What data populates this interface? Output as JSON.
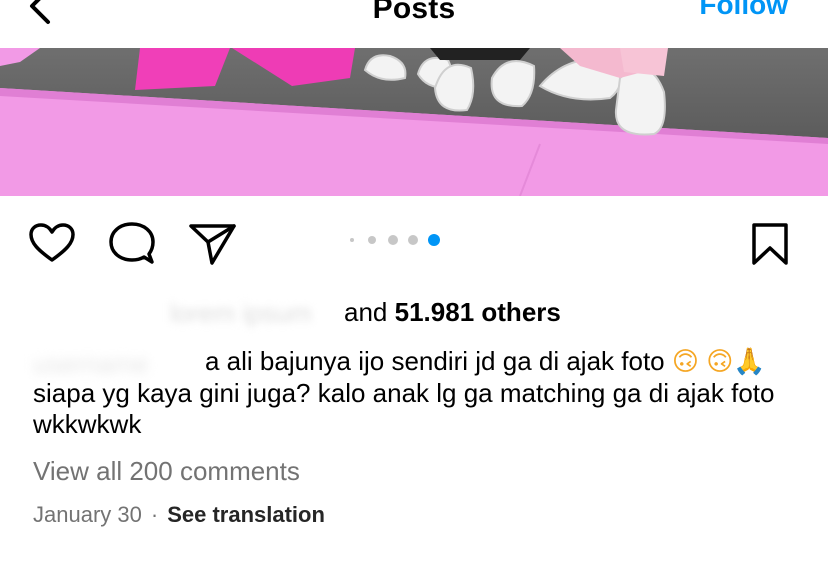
{
  "header": {
    "title": "Posts",
    "follow_label": "Follow"
  },
  "carousel": {
    "count": 5,
    "active_index": 4
  },
  "likes": {
    "prefix": "and",
    "count": "51.981",
    "suffix": "others"
  },
  "caption": {
    "line1": "a ali bajunya ijo sendiri jd ga di ajak foto",
    "line2": "siapa yg kaya gini juga? kalo anak lg ga matching ga di ajak foto wkkwkwk",
    "emoji_smile": "🙃",
    "emoji_pray": "🙏"
  },
  "comments": {
    "view_all": "View all 200 comments"
  },
  "meta": {
    "date": "January 30",
    "separator": "·",
    "see_translation": "See translation"
  },
  "colors": {
    "accent": "#0095f6",
    "muted": "#737373",
    "pink": "#f29ae6"
  },
  "icons": [
    "back-chevron-icon",
    "heart-icon",
    "comment-icon",
    "share-icon",
    "bookmark-icon"
  ]
}
